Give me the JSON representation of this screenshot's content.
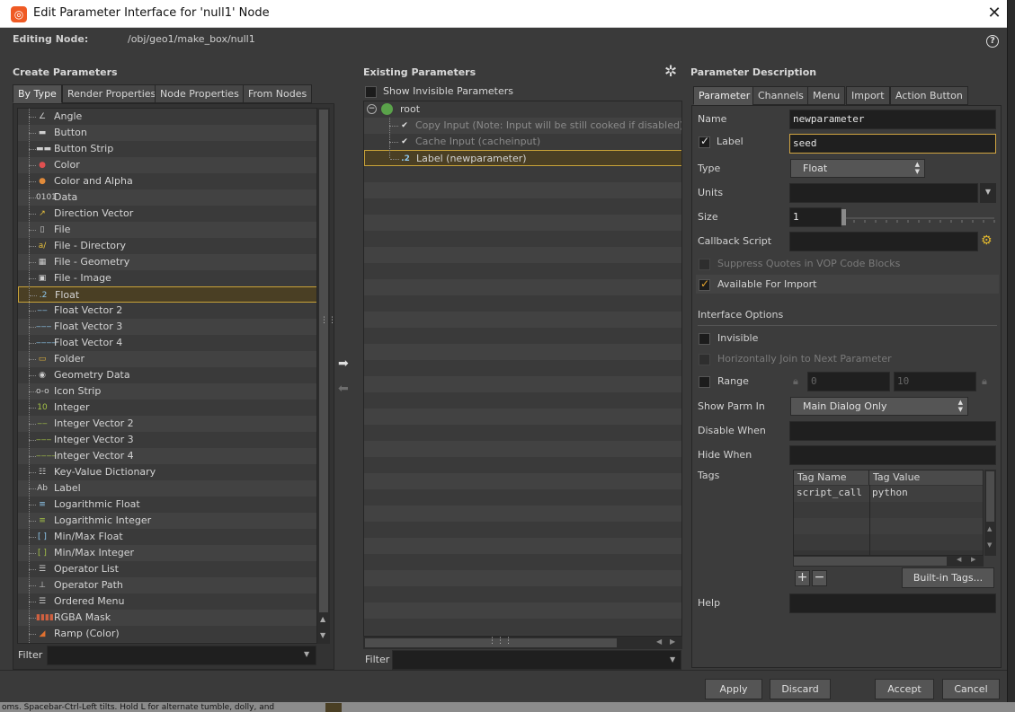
{
  "window": {
    "title": "Edit Parameter Interface for 'null1' Node",
    "close_glyph": "✕"
  },
  "header": {
    "editing_label": "Editing Node:",
    "node_path": "/obj/geo1/make_box/null1",
    "help_glyph": "?"
  },
  "create": {
    "title": "Create Parameters",
    "tabs": [
      "By Type",
      "Render Properties",
      "Node Properties",
      "From Nodes"
    ],
    "items": [
      {
        "label": "Angle",
        "icon": "angle-icon",
        "glyph": "∠"
      },
      {
        "label": "Button",
        "icon": "button-icon",
        "glyph": "▬"
      },
      {
        "label": "Button Strip",
        "icon": "button-strip-icon",
        "glyph": "▬▬"
      },
      {
        "label": "Color",
        "icon": "color-icon",
        "glyph": "●"
      },
      {
        "label": "Color and Alpha",
        "icon": "color-alpha-icon",
        "glyph": "●"
      },
      {
        "label": "Data",
        "icon": "data-icon",
        "glyph": "0101"
      },
      {
        "label": "Direction Vector",
        "icon": "direction-vector-icon",
        "glyph": "↗"
      },
      {
        "label": "File",
        "icon": "file-icon",
        "glyph": "▯"
      },
      {
        "label": "File - Directory",
        "icon": "file-directory-icon",
        "glyph": "a/"
      },
      {
        "label": "File - Geometry",
        "icon": "file-geometry-icon",
        "glyph": "▦"
      },
      {
        "label": "File - Image",
        "icon": "file-image-icon",
        "glyph": "▣"
      },
      {
        "label": "Float",
        "icon": "float-icon",
        "glyph": ".2"
      },
      {
        "label": "Float Vector 2",
        "icon": "float-vector2-icon",
        "glyph": "‒‒"
      },
      {
        "label": "Float Vector 3",
        "icon": "float-vector3-icon",
        "glyph": "‒‒‒"
      },
      {
        "label": "Float Vector 4",
        "icon": "float-vector4-icon",
        "glyph": "‒‒‒‒"
      },
      {
        "label": "Folder",
        "icon": "folder-icon",
        "glyph": "▭"
      },
      {
        "label": "Geometry Data",
        "icon": "geometry-data-icon",
        "glyph": "◉"
      },
      {
        "label": "Icon Strip",
        "icon": "icon-strip-icon",
        "glyph": "o-o"
      },
      {
        "label": "Integer",
        "icon": "integer-icon",
        "glyph": "10"
      },
      {
        "label": "Integer Vector 2",
        "icon": "integer-vector2-icon",
        "glyph": "‒‒"
      },
      {
        "label": "Integer Vector 3",
        "icon": "integer-vector3-icon",
        "glyph": "‒‒‒"
      },
      {
        "label": "Integer Vector 4",
        "icon": "integer-vector4-icon",
        "glyph": "‒‒‒‒"
      },
      {
        "label": "Key-Value Dictionary",
        "icon": "key-value-dictionary-icon",
        "glyph": "☷"
      },
      {
        "label": "Label",
        "icon": "label-icon",
        "glyph": "Ab"
      },
      {
        "label": "Logarithmic Float",
        "icon": "log-float-icon",
        "glyph": "≡"
      },
      {
        "label": "Logarithmic Integer",
        "icon": "log-integer-icon",
        "glyph": "≡"
      },
      {
        "label": "Min/Max Float",
        "icon": "minmax-float-icon",
        "glyph": "[ ]"
      },
      {
        "label": "Min/Max Integer",
        "icon": "minmax-integer-icon",
        "glyph": "[ ]"
      },
      {
        "label": "Operator List",
        "icon": "operator-list-icon",
        "glyph": "☰"
      },
      {
        "label": "Operator Path",
        "icon": "operator-path-icon",
        "glyph": "⊥"
      },
      {
        "label": "Ordered Menu",
        "icon": "ordered-menu-icon",
        "glyph": "☰"
      },
      {
        "label": "RGBA Mask",
        "icon": "rgba-mask-icon",
        "glyph": "▮▮▮▮"
      },
      {
        "label": "Ramp (Color)",
        "icon": "ramp-color-icon",
        "glyph": "◢"
      }
    ],
    "selected_index": 11,
    "filter_label": "Filter"
  },
  "existing": {
    "title": "Existing Parameters",
    "show_invisible_label": "Show Invisible Parameters",
    "root_label": "root",
    "items": [
      {
        "label": "Copy Input (Note: Input will be still cooked if disabled) (copy",
        "dim": true
      },
      {
        "label": "Cache Input (cacheinput)",
        "dim": true
      },
      {
        "label": "Label (newparameter)",
        "dim": false
      }
    ],
    "filter_label": "Filter"
  },
  "desc": {
    "title": "Parameter Description",
    "tabs": [
      "Parameter",
      "Channels",
      "Menu",
      "Import",
      "Action Button"
    ],
    "name_label": "Name",
    "name_value": "newparameter",
    "label_label": "Label",
    "label_value": "seed",
    "type_label": "Type",
    "type_value": "Float",
    "units_label": "Units",
    "size_label": "Size",
    "size_value": "1",
    "callback_label": "Callback Script",
    "suppress_label": "Suppress Quotes in VOP Code Blocks",
    "import_label": "Available For Import",
    "interface_label": "Interface Options",
    "invisible_label": "Invisible",
    "hjoin_label": "Horizontally Join to Next Parameter",
    "range_label": "Range",
    "range_min": "0",
    "range_max": "10",
    "showparm_label": "Show Parm In",
    "showparm_value": "Main Dialog Only",
    "disable_label": "Disable When",
    "hide_label": "Hide When",
    "tags_label": "Tags",
    "tags_headers": [
      "Tag Name",
      "Tag Value"
    ],
    "tags_rows": [
      {
        "name": "script_call",
        "value": "python"
      }
    ],
    "builtin_tags": "Built-in Tags...",
    "help_label": "Help"
  },
  "footer": {
    "apply": "Apply",
    "discard": "Discard",
    "accept": "Accept",
    "cancel": "Cancel",
    "status_text": "oms. Spacebar-Ctrl-Left tilts. Hold L for alternate tumble, dolly, and"
  },
  "colors": {
    "accent": "#d2a642",
    "panel": "#3a3a3a",
    "field": "#1f1f1f",
    "title_bar": "#ffffff"
  }
}
